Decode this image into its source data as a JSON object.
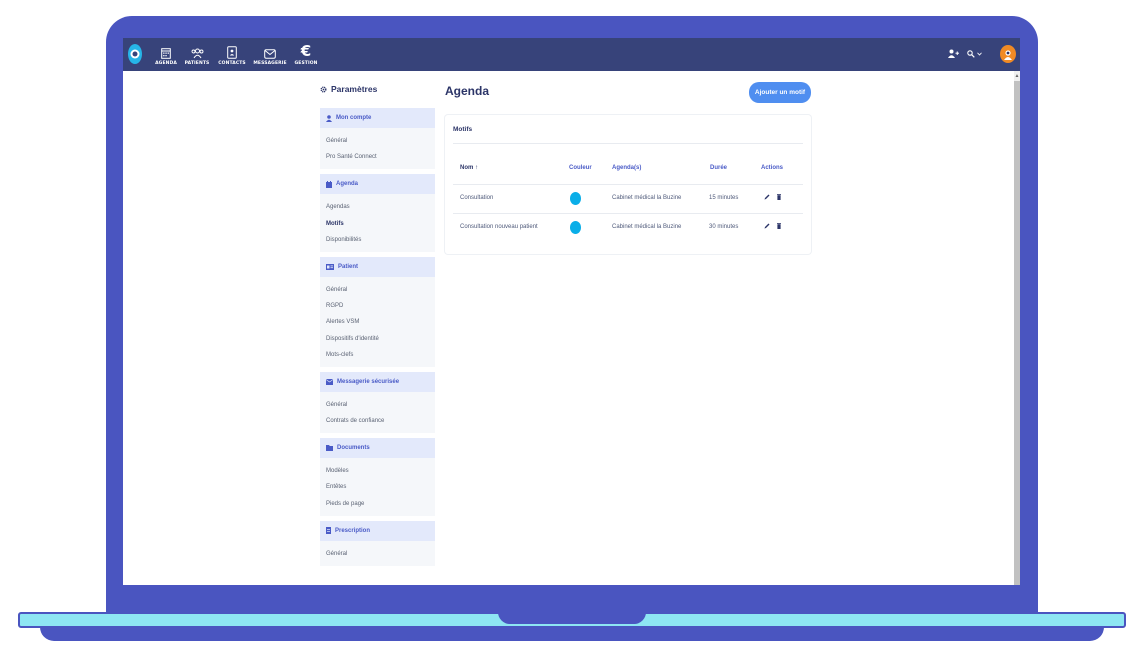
{
  "nav": {
    "items": [
      {
        "label": "AGENDA",
        "icon": "calendar-icon"
      },
      {
        "label": "PATIENTS",
        "icon": "patients-icon"
      },
      {
        "label": "CONTACTS",
        "icon": "contacts-icon"
      },
      {
        "label": "MESSAGERIE",
        "icon": "mail-icon"
      },
      {
        "label": "GESTION",
        "icon": "euro-icon"
      }
    ]
  },
  "settings": {
    "title": "Paramètres",
    "sections": [
      {
        "label": "Mon compte",
        "icon": "user-icon",
        "links": [
          "Général",
          "Pro Santé Connect"
        ]
      },
      {
        "label": "Agenda",
        "icon": "calendar-icon",
        "links": [
          "Agendas",
          "Motifs",
          "Disponibilités"
        ]
      },
      {
        "label": "Patient",
        "icon": "id-card-icon",
        "links": [
          "Général",
          "RGPD",
          "Alertes VSM",
          "Dispositifs d'identité",
          "Mots-clefs"
        ]
      },
      {
        "label": "Messagerie sécurisée",
        "icon": "envelope-icon",
        "links": [
          "Général",
          "Contrats de confiance"
        ]
      },
      {
        "label": "Documents",
        "icon": "folder-icon",
        "links": [
          "Modèles",
          "Entêtes",
          "Pieds de page"
        ]
      },
      {
        "label": "Prescription",
        "icon": "prescription-icon",
        "links": [
          "Général"
        ]
      }
    ]
  },
  "main": {
    "title": "Agenda",
    "add_button": "Ajouter un motif",
    "card_title": "Motifs",
    "columns": {
      "name": "Nom ↑",
      "color": "Couleur",
      "agendas": "Agenda(s)",
      "duration": "Durée",
      "actions": "Actions"
    },
    "rows": [
      {
        "name": "Consultation",
        "color": "#0aaee8",
        "agenda": "Cabinet médical la Buzine",
        "duration": "15 minutes"
      },
      {
        "name": "Consultation nouveau patient",
        "color": "#0aaee8",
        "agenda": "Cabinet médical la Buzine",
        "duration": "30 minutes"
      }
    ]
  },
  "colors": {
    "topbar": "#37437a",
    "accent": "#4f8ef0",
    "frame": "#4a55c0"
  }
}
